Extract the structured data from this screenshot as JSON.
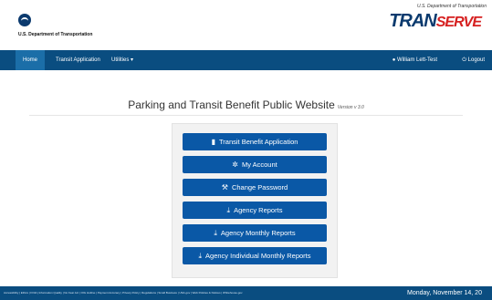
{
  "header": {
    "dot_name": "U.S. Department of Transportation",
    "transerve_dept": "U.S. Department of Transportation",
    "transerve_logo_a": "TRAN",
    "transerve_logo_b": "SERVE"
  },
  "nav": {
    "home": "Home",
    "transit_application": "Transit Application",
    "utilities": "Utilities",
    "user": "William Lett-Test",
    "logout": "Logout"
  },
  "main": {
    "title": "Parking and Transit Benefit Public Website",
    "version": "Version v 3.0",
    "buttons": [
      {
        "label": "Transit Benefit Application",
        "icon": "file-icon",
        "glyph": "▮"
      },
      {
        "label": "My Account",
        "icon": "gear-icon",
        "glyph": "✲"
      },
      {
        "label": "Change Password",
        "icon": "wrench-icon",
        "glyph": "⚒"
      },
      {
        "label": "Agency Reports",
        "icon": "download-icon",
        "glyph": "⤓"
      },
      {
        "label": "Agency Monthly Reports",
        "icon": "download-icon",
        "glyph": "⤓"
      },
      {
        "label": "Agency Individual Monthly Reports",
        "icon": "download-icon",
        "glyph": "⤓"
      }
    ]
  },
  "footer": {
    "links": "Accessibility | Ethics | FOIA | Information Quality | No Fear Act | OIG Hotline | Payment Accuracy | Privacy Policy | Regulations | Small Business | USA.gov | Web Policies & Notices | Whitehouse.gov",
    "date": "Monday, November 14, 20"
  },
  "colors": {
    "navbar": "#0a4d80",
    "button": "#0a58a6",
    "logo_red": "#d62020"
  }
}
